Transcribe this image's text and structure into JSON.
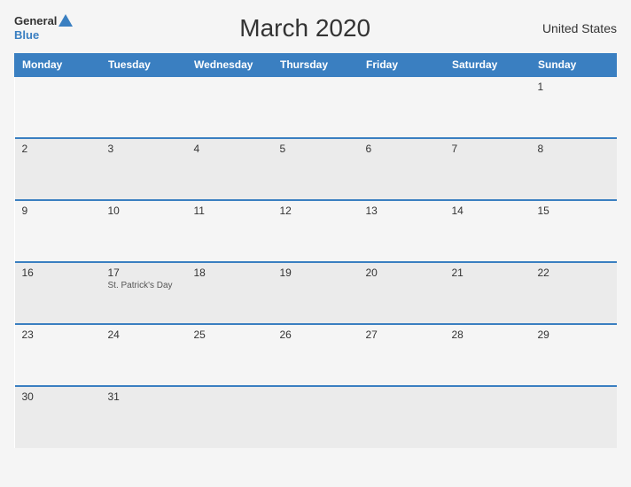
{
  "header": {
    "logo_general": "General",
    "logo_blue": "Blue",
    "title": "March 2020",
    "country": "United States"
  },
  "weekdays": [
    "Monday",
    "Tuesday",
    "Wednesday",
    "Thursday",
    "Friday",
    "Saturday",
    "Sunday"
  ],
  "weeks": [
    [
      {
        "day": "",
        "holiday": ""
      },
      {
        "day": "",
        "holiday": ""
      },
      {
        "day": "",
        "holiday": ""
      },
      {
        "day": "",
        "holiday": ""
      },
      {
        "day": "",
        "holiday": ""
      },
      {
        "day": "",
        "holiday": ""
      },
      {
        "day": "1",
        "holiday": ""
      }
    ],
    [
      {
        "day": "2",
        "holiday": ""
      },
      {
        "day": "3",
        "holiday": ""
      },
      {
        "day": "4",
        "holiday": ""
      },
      {
        "day": "5",
        "holiday": ""
      },
      {
        "day": "6",
        "holiday": ""
      },
      {
        "day": "7",
        "holiday": ""
      },
      {
        "day": "8",
        "holiday": ""
      }
    ],
    [
      {
        "day": "9",
        "holiday": ""
      },
      {
        "day": "10",
        "holiday": ""
      },
      {
        "day": "11",
        "holiday": ""
      },
      {
        "day": "12",
        "holiday": ""
      },
      {
        "day": "13",
        "holiday": ""
      },
      {
        "day": "14",
        "holiday": ""
      },
      {
        "day": "15",
        "holiday": ""
      }
    ],
    [
      {
        "day": "16",
        "holiday": ""
      },
      {
        "day": "17",
        "holiday": "St. Patrick's Day"
      },
      {
        "day": "18",
        "holiday": ""
      },
      {
        "day": "19",
        "holiday": ""
      },
      {
        "day": "20",
        "holiday": ""
      },
      {
        "day": "21",
        "holiday": ""
      },
      {
        "day": "22",
        "holiday": ""
      }
    ],
    [
      {
        "day": "23",
        "holiday": ""
      },
      {
        "day": "24",
        "holiday": ""
      },
      {
        "day": "25",
        "holiday": ""
      },
      {
        "day": "26",
        "holiday": ""
      },
      {
        "day": "27",
        "holiday": ""
      },
      {
        "day": "28",
        "holiday": ""
      },
      {
        "day": "29",
        "holiday": ""
      }
    ],
    [
      {
        "day": "30",
        "holiday": ""
      },
      {
        "day": "31",
        "holiday": ""
      },
      {
        "day": "",
        "holiday": ""
      },
      {
        "day": "",
        "holiday": ""
      },
      {
        "day": "",
        "holiday": ""
      },
      {
        "day": "",
        "holiday": ""
      },
      {
        "day": "",
        "holiday": ""
      }
    ]
  ]
}
